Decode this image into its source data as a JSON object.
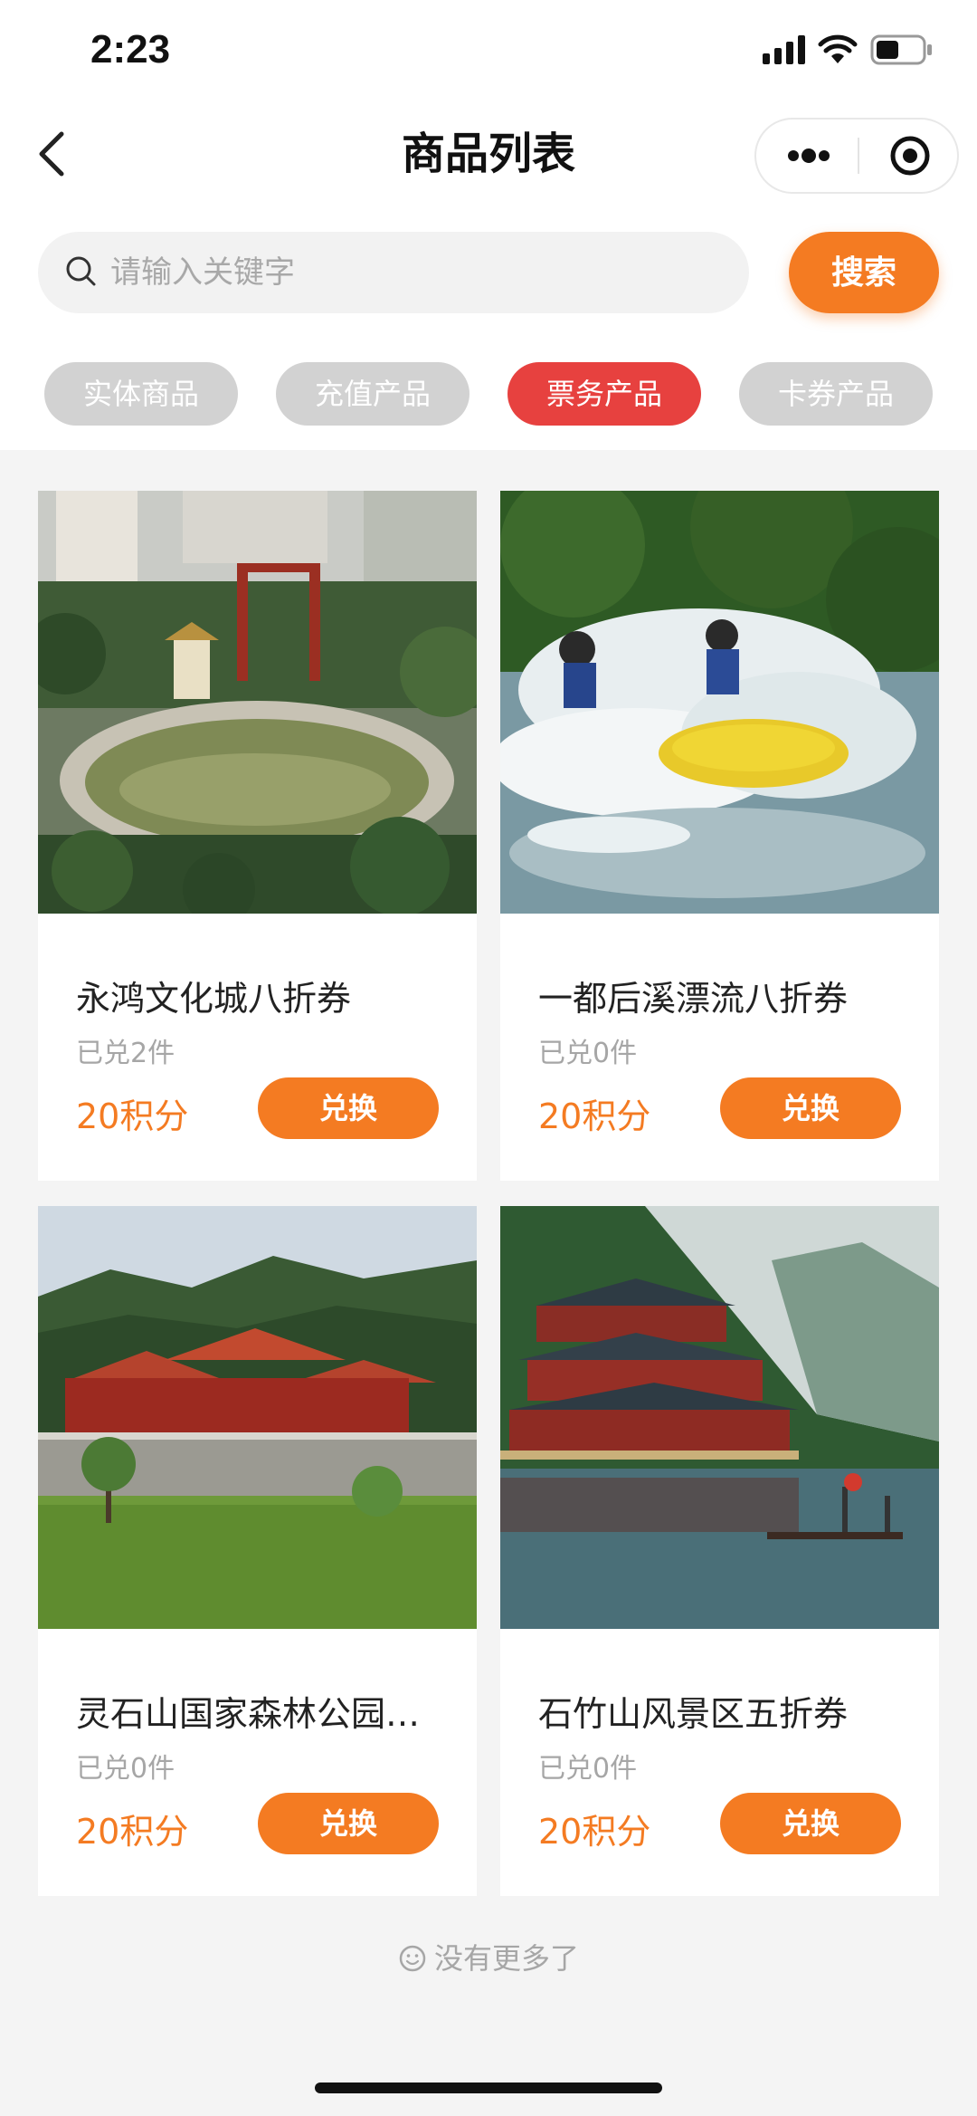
{
  "status_bar": {
    "time": "2:23"
  },
  "nav": {
    "title": "商品列表"
  },
  "search": {
    "placeholder": "请输入关键字",
    "button_label": "搜索"
  },
  "tabs": [
    {
      "label": "实体商品",
      "active": false
    },
    {
      "label": "充值产品",
      "active": false
    },
    {
      "label": "票务产品",
      "active": true
    },
    {
      "label": "卡券产品",
      "active": false
    }
  ],
  "products": [
    {
      "name": "永鸿文化城八折券",
      "sold": "已兑2件",
      "price": "20积分",
      "button": "兑换"
    },
    {
      "name": "一都后溪漂流八折券",
      "sold": "已兑0件",
      "price": "20积分",
      "button": "兑换"
    },
    {
      "name": "灵石山国家森林公园…",
      "sold": "已兑0件",
      "price": "20积分",
      "button": "兑换"
    },
    {
      "name": "石竹山风景区五折券",
      "sold": "已兑0件",
      "price": "20积分",
      "button": "兑换"
    }
  ],
  "footer": {
    "no_more": "没有更多了"
  },
  "colors": {
    "accent": "#f47b22",
    "active_tab": "#e7413f",
    "inactive_tab": "#d2d2d2"
  }
}
